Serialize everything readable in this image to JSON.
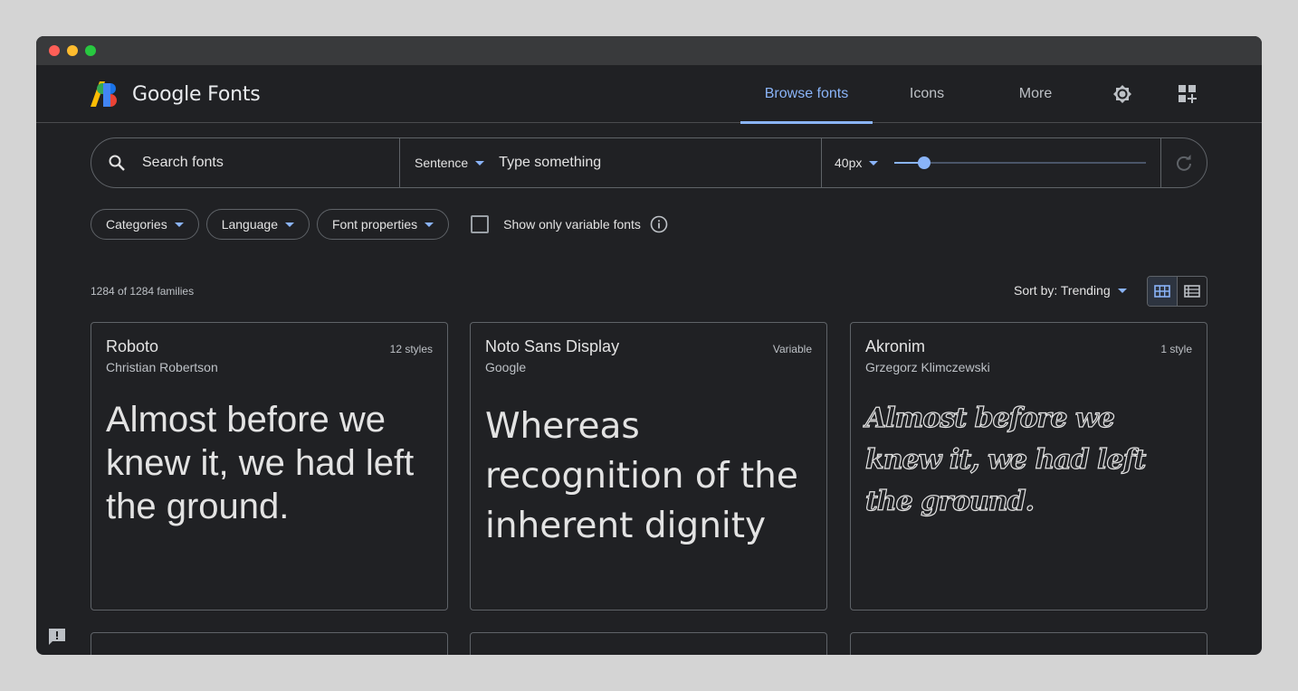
{
  "brand": {
    "logo_text": "Google Fonts"
  },
  "nav": {
    "tabs": [
      {
        "label": "Browse fonts",
        "active": true
      },
      {
        "label": "Icons",
        "active": false
      },
      {
        "label": "More",
        "active": false
      }
    ],
    "icons": [
      "theme-toggle-icon",
      "apps-add-icon"
    ]
  },
  "search": {
    "placeholder": "Search fonts",
    "preview_mode": "Sentence",
    "preview_placeholder": "Type something",
    "size_label": "40px",
    "size_slider_fraction": 0.12
  },
  "filters": {
    "chips": [
      "Categories",
      "Language",
      "Font properties"
    ],
    "variable_checkbox_label": "Show only variable fonts",
    "variable_checked": false
  },
  "results": {
    "count_text": "1284 of 1284 families",
    "sort_label": "Sort by: Trending"
  },
  "cards": [
    {
      "name": "Roboto",
      "author": "Christian Robertson",
      "styles": "12 styles",
      "sample": "Almost before we knew it, we had left the ground."
    },
    {
      "name": "Noto Sans Display",
      "author": "Google",
      "styles": "Variable",
      "sample": "Whereas recognition of the inherent dignity"
    },
    {
      "name": "Akronim",
      "author": "Grzegorz Klimczewski",
      "styles": "1 style",
      "sample": "Almost before we knew it, we had left the ground."
    }
  ],
  "colors": {
    "accent": "#8ab4f8",
    "background": "#202124",
    "border": "#5f6368"
  }
}
